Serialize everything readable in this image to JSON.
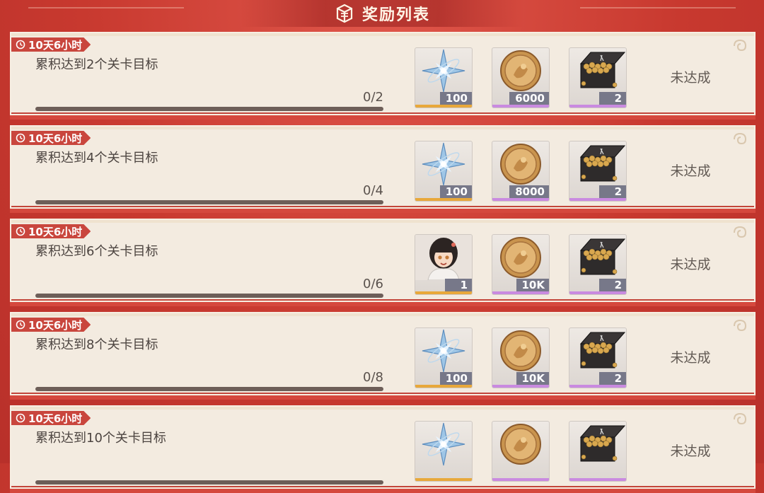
{
  "header": {
    "title": "奖励列表",
    "icon": "gift-icon"
  },
  "colors": {
    "timer_bg": "#c9463d",
    "rarity_gold": "#e8a83a",
    "rarity_purple": "#c98ae0",
    "progress_track": "#6d5e58"
  },
  "rewards_list": [
    {
      "timer": "10天6小时",
      "goal": "累积达到2个关卡目标",
      "progress_text": "0/2",
      "progress_fraction": 0,
      "status": "未达成",
      "rewards": [
        {
          "icon": "crystal-star-icon",
          "qty": "100",
          "rarity": "gold"
        },
        {
          "icon": "gold-coin-icon",
          "qty": "6000",
          "rarity": "purple"
        },
        {
          "icon": "treasure-chest-icon",
          "qty": "2",
          "rarity": "purple"
        }
      ]
    },
    {
      "timer": "10天6小时",
      "goal": "累积达到4个关卡目标",
      "progress_text": "0/4",
      "progress_fraction": 0,
      "status": "未达成",
      "rewards": [
        {
          "icon": "crystal-star-icon",
          "qty": "100",
          "rarity": "gold"
        },
        {
          "icon": "gold-coin-icon",
          "qty": "8000",
          "rarity": "purple"
        },
        {
          "icon": "treasure-chest-icon",
          "qty": "2",
          "rarity": "purple"
        }
      ]
    },
    {
      "timer": "10天6小时",
      "goal": "累积达到6个关卡目标",
      "progress_text": "0/6",
      "progress_fraction": 0,
      "status": "未达成",
      "rewards": [
        {
          "icon": "character-portrait-icon",
          "qty": "1",
          "rarity": "gold"
        },
        {
          "icon": "gold-coin-icon",
          "qty": "10K",
          "rarity": "purple"
        },
        {
          "icon": "treasure-chest-icon",
          "qty": "2",
          "rarity": "purple"
        }
      ]
    },
    {
      "timer": "10天6小时",
      "goal": "累积达到8个关卡目标",
      "progress_text": "0/8",
      "progress_fraction": 0,
      "status": "未达成",
      "rewards": [
        {
          "icon": "crystal-star-icon",
          "qty": "100",
          "rarity": "gold"
        },
        {
          "icon": "gold-coin-icon",
          "qty": "10K",
          "rarity": "purple"
        },
        {
          "icon": "treasure-chest-icon",
          "qty": "2",
          "rarity": "purple"
        }
      ]
    },
    {
      "timer": "10天6小时",
      "goal": "累积达到10个关卡目标",
      "progress_text": "",
      "progress_fraction": 0,
      "status": "未达成",
      "rewards": [
        {
          "icon": "crystal-star-icon",
          "qty": "",
          "rarity": "gold"
        },
        {
          "icon": "gold-coin-icon",
          "qty": "",
          "rarity": "purple"
        },
        {
          "icon": "treasure-chest-icon",
          "qty": "",
          "rarity": "purple"
        }
      ]
    }
  ]
}
